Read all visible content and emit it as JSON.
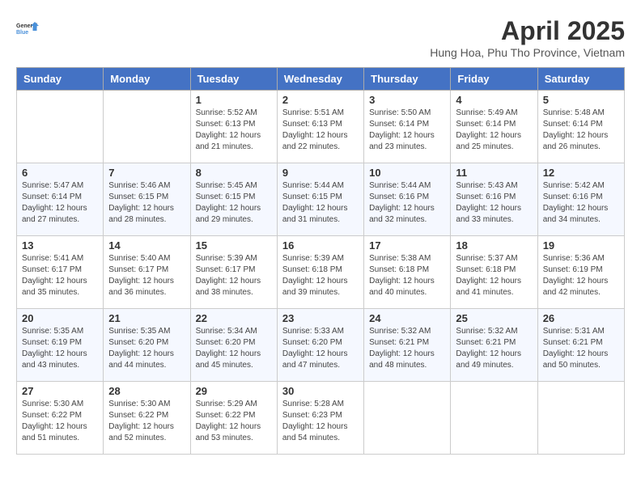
{
  "logo": {
    "line1": "General",
    "line2": "Blue"
  },
  "title": "April 2025",
  "subtitle": "Hung Hoa, Phu Tho Province, Vietnam",
  "days_of_week": [
    "Sunday",
    "Monday",
    "Tuesday",
    "Wednesday",
    "Thursday",
    "Friday",
    "Saturday"
  ],
  "weeks": [
    [
      {
        "day": "",
        "info": ""
      },
      {
        "day": "",
        "info": ""
      },
      {
        "day": "1",
        "info": "Sunrise: 5:52 AM\nSunset: 6:13 PM\nDaylight: 12 hours and 21 minutes."
      },
      {
        "day": "2",
        "info": "Sunrise: 5:51 AM\nSunset: 6:13 PM\nDaylight: 12 hours and 22 minutes."
      },
      {
        "day": "3",
        "info": "Sunrise: 5:50 AM\nSunset: 6:14 PM\nDaylight: 12 hours and 23 minutes."
      },
      {
        "day": "4",
        "info": "Sunrise: 5:49 AM\nSunset: 6:14 PM\nDaylight: 12 hours and 25 minutes."
      },
      {
        "day": "5",
        "info": "Sunrise: 5:48 AM\nSunset: 6:14 PM\nDaylight: 12 hours and 26 minutes."
      }
    ],
    [
      {
        "day": "6",
        "info": "Sunrise: 5:47 AM\nSunset: 6:14 PM\nDaylight: 12 hours and 27 minutes."
      },
      {
        "day": "7",
        "info": "Sunrise: 5:46 AM\nSunset: 6:15 PM\nDaylight: 12 hours and 28 minutes."
      },
      {
        "day": "8",
        "info": "Sunrise: 5:45 AM\nSunset: 6:15 PM\nDaylight: 12 hours and 29 minutes."
      },
      {
        "day": "9",
        "info": "Sunrise: 5:44 AM\nSunset: 6:15 PM\nDaylight: 12 hours and 31 minutes."
      },
      {
        "day": "10",
        "info": "Sunrise: 5:44 AM\nSunset: 6:16 PM\nDaylight: 12 hours and 32 minutes."
      },
      {
        "day": "11",
        "info": "Sunrise: 5:43 AM\nSunset: 6:16 PM\nDaylight: 12 hours and 33 minutes."
      },
      {
        "day": "12",
        "info": "Sunrise: 5:42 AM\nSunset: 6:16 PM\nDaylight: 12 hours and 34 minutes."
      }
    ],
    [
      {
        "day": "13",
        "info": "Sunrise: 5:41 AM\nSunset: 6:17 PM\nDaylight: 12 hours and 35 minutes."
      },
      {
        "day": "14",
        "info": "Sunrise: 5:40 AM\nSunset: 6:17 PM\nDaylight: 12 hours and 36 minutes."
      },
      {
        "day": "15",
        "info": "Sunrise: 5:39 AM\nSunset: 6:17 PM\nDaylight: 12 hours and 38 minutes."
      },
      {
        "day": "16",
        "info": "Sunrise: 5:39 AM\nSunset: 6:18 PM\nDaylight: 12 hours and 39 minutes."
      },
      {
        "day": "17",
        "info": "Sunrise: 5:38 AM\nSunset: 6:18 PM\nDaylight: 12 hours and 40 minutes."
      },
      {
        "day": "18",
        "info": "Sunrise: 5:37 AM\nSunset: 6:18 PM\nDaylight: 12 hours and 41 minutes."
      },
      {
        "day": "19",
        "info": "Sunrise: 5:36 AM\nSunset: 6:19 PM\nDaylight: 12 hours and 42 minutes."
      }
    ],
    [
      {
        "day": "20",
        "info": "Sunrise: 5:35 AM\nSunset: 6:19 PM\nDaylight: 12 hours and 43 minutes."
      },
      {
        "day": "21",
        "info": "Sunrise: 5:35 AM\nSunset: 6:20 PM\nDaylight: 12 hours and 44 minutes."
      },
      {
        "day": "22",
        "info": "Sunrise: 5:34 AM\nSunset: 6:20 PM\nDaylight: 12 hours and 45 minutes."
      },
      {
        "day": "23",
        "info": "Sunrise: 5:33 AM\nSunset: 6:20 PM\nDaylight: 12 hours and 47 minutes."
      },
      {
        "day": "24",
        "info": "Sunrise: 5:32 AM\nSunset: 6:21 PM\nDaylight: 12 hours and 48 minutes."
      },
      {
        "day": "25",
        "info": "Sunrise: 5:32 AM\nSunset: 6:21 PM\nDaylight: 12 hours and 49 minutes."
      },
      {
        "day": "26",
        "info": "Sunrise: 5:31 AM\nSunset: 6:21 PM\nDaylight: 12 hours and 50 minutes."
      }
    ],
    [
      {
        "day": "27",
        "info": "Sunrise: 5:30 AM\nSunset: 6:22 PM\nDaylight: 12 hours and 51 minutes."
      },
      {
        "day": "28",
        "info": "Sunrise: 5:30 AM\nSunset: 6:22 PM\nDaylight: 12 hours and 52 minutes."
      },
      {
        "day": "29",
        "info": "Sunrise: 5:29 AM\nSunset: 6:22 PM\nDaylight: 12 hours and 53 minutes."
      },
      {
        "day": "30",
        "info": "Sunrise: 5:28 AM\nSunset: 6:23 PM\nDaylight: 12 hours and 54 minutes."
      },
      {
        "day": "",
        "info": ""
      },
      {
        "day": "",
        "info": ""
      },
      {
        "day": "",
        "info": ""
      }
    ]
  ]
}
